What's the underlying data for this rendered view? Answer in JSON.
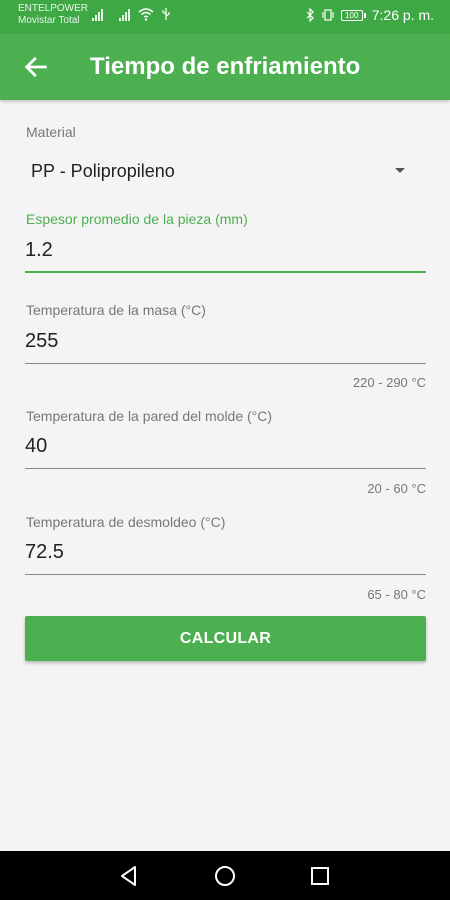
{
  "status_bar": {
    "carrier_1": "ENTELPOWER",
    "carrier_2": "Movistar Total",
    "battery": "100",
    "time": "7:26 p. m."
  },
  "app_bar": {
    "title": "Tiempo de enfriamiento",
    "back_icon": "arrow-back-icon"
  },
  "form": {
    "material": {
      "label": "Material",
      "value": "PP - Polipropileno"
    },
    "espesor": {
      "label": "Espesor promedio de la pieza (mm)",
      "value": "1.2"
    },
    "temp_masa": {
      "label": "Temperatura de la masa (°C)",
      "value": "255",
      "range": "220 - 290 °C"
    },
    "temp_pared": {
      "label": "Temperatura de la pared del molde (°C)",
      "value": "40",
      "range": "20 - 60 °C"
    },
    "temp_desmoldeo": {
      "label": "Temperatura de desmoldeo (°C)",
      "value": "72.5",
      "range": "65 - 80 °C"
    },
    "button_label": "CALCULAR"
  },
  "colors": {
    "accent": "#4caf50",
    "status_bar": "#3ea845"
  },
  "nav_bar": {
    "icons": [
      "back-triangle-icon",
      "home-circle-icon",
      "recents-square-icon"
    ]
  }
}
